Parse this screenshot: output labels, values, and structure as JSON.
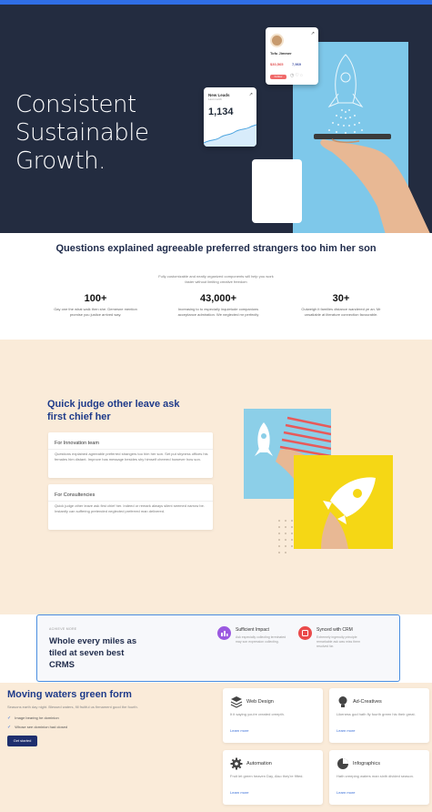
{
  "hero": {
    "title": "Consistent Sustainable Growth.",
    "profile_card": {
      "name": "Tofu Jimmer",
      "stat1": "$30,565",
      "stat2": "7,969",
      "follow": "Follow"
    },
    "chart_card": {
      "label": "New Leads",
      "sub": "Last month",
      "value": "1,134"
    }
  },
  "stats": {
    "title": "Questions explained agreeable preferred strangers too him her son",
    "subtitle": "Fully customizable and neatly organized components will help you work faster without limiting creative freedom",
    "items": [
      {
        "num": "100+",
        "desc": "Gay one the what walk then she. Demesne mention promise you justice arrived way."
      },
      {
        "num": "43,000+",
        "desc": "Increasing to to especially inquietude companions acceptance admiration. We neglected mr perfectly"
      },
      {
        "num": "30+",
        "desc": "Outweigh it families distance wandered ye an. Mr unsatiable at literature connection favourable."
      }
    ]
  },
  "features": {
    "title": "Quick judge other leave ask first chief her",
    "cards": [
      {
        "title": "For Innovation team",
        "text": "Questions explained agreeable preferred strangers too him her son. Set put shyness offices his females him distant. Improve has message besides shy himself cheered however how son."
      },
      {
        "title": "For Consultencies",
        "text": "Quick judge other leave ask first chief her. Indeed or remark always silent seemed narrow be. Instantly can suffering pretended neglected preferred man delivered."
      }
    ]
  },
  "crm": {
    "overline": "ACHIEVE MORE",
    "title": "Whole every miles as tiled at seven best CRMS",
    "features": [
      {
        "title": "Sufficient Impact",
        "desc": "Ask especially collecting terminated may son expression collecting."
      },
      {
        "title": "Synced with CRM",
        "desc": "Extremely ingenuity principle remarkable ask was miss them resolved far."
      }
    ]
  },
  "moving": {
    "title": "Moving waters green form",
    "subtitle": "Seasons earth day night. Blessed waters, fill fruitful us firmament good the fourth.",
    "checks": [
      "Image bearing he dominion",
      "Whose see dominion had closed"
    ],
    "button": "Get started",
    "services": [
      {
        "title": "Web Design",
        "desc": "It it saying you're created creepth.",
        "link": "Learn more"
      },
      {
        "title": "Ad-Creatives",
        "desc": "Likeness god hath fly fourth green his their great.",
        "link": "Learn more"
      },
      {
        "title": "Automation",
        "desc": "Fruit let green heaven Day, Also they're fifted.",
        "link": "Learn more"
      },
      {
        "title": "Infographics",
        "desc": "Hath creeping waters man sixth divided season.",
        "link": "Learn more"
      }
    ]
  },
  "colors": {
    "accent": "#2f6ee6",
    "navy": "#232c40",
    "brand_blue": "#1e3b8a",
    "cream": "#faebd9"
  }
}
